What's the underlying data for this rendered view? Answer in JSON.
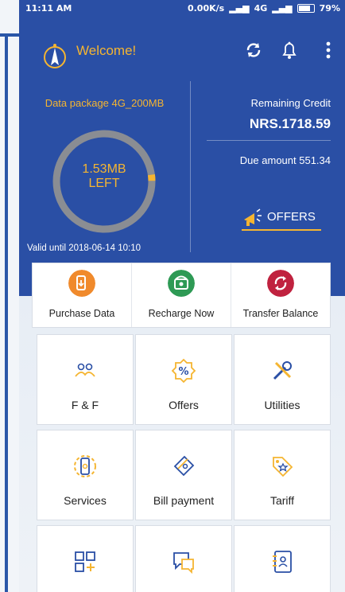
{
  "status_bar": {
    "time": "11:11 AM",
    "speed": "0.00K/s",
    "network": "4G",
    "battery": "79%"
  },
  "header": {
    "welcome": "Welcome!",
    "package_name": "Data package 4G_200MB",
    "data_left": "1.53MB",
    "data_left_suffix": "LEFT",
    "data_left_fraction": 0.02,
    "valid_until": "Valid  until 2018-06-14 10:10",
    "remaining_credit_label": "Remaining Credit",
    "remaining_credit_value": "NRS.1718.59",
    "due_amount": "Due amount  551.34",
    "offers_label": "OFFERS"
  },
  "quick_actions": [
    {
      "label": "Purchase Data",
      "icon": "purchase-data-icon",
      "color": "#f08a2c"
    },
    {
      "label": "Recharge Now",
      "icon": "recharge-icon",
      "color": "#2e9a55"
    },
    {
      "label": "Transfer Balance",
      "icon": "transfer-icon",
      "color": "#c0223f"
    }
  ],
  "tiles": [
    {
      "label": "F & F",
      "icon": "friends-family-icon"
    },
    {
      "label": "Offers",
      "icon": "percent-badge-icon"
    },
    {
      "label": "Utilities",
      "icon": "tools-icon"
    },
    {
      "label": "Services",
      "icon": "phone-gear-icon"
    },
    {
      "label": "Bill payment",
      "icon": "bill-tag-icon"
    },
    {
      "label": "Tariff",
      "icon": "price-tag-icon"
    },
    {
      "label": "",
      "icon": "add-apps-icon"
    },
    {
      "label": "",
      "icon": "chat-icon"
    },
    {
      "label": "",
      "icon": "contacts-icon"
    }
  ],
  "colors": {
    "brand_blue": "#2a4fa5",
    "accent": "#f5b531",
    "icon_blue": "#2a4fa5"
  }
}
